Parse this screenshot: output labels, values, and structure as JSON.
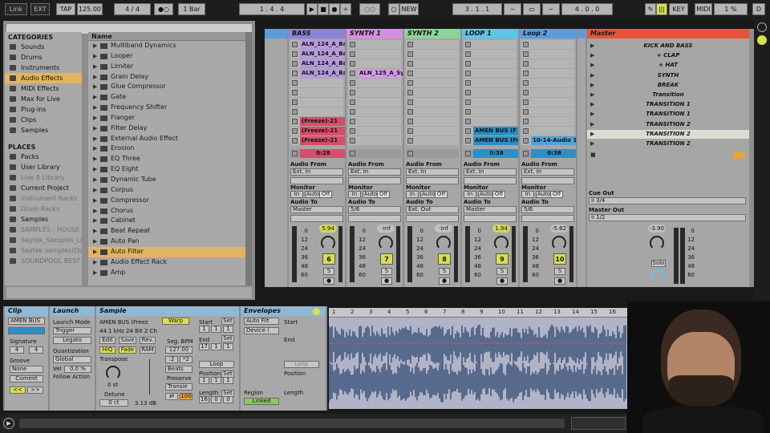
{
  "topbar": {
    "link": "Link",
    "ext": "EXT",
    "tap": "TAP",
    "tempo": "125.00",
    "sig": "4 / 4",
    "metro": "1 Bar",
    "position": "1 .   4 .   4",
    "new": "NEW",
    "loop_start": "3 .   1 .   1",
    "loop_len": "4 .   0 .   0",
    "key": "KEY",
    "midi": "MIDI",
    "cpu": "1 %",
    "d": "D"
  },
  "browser": {
    "categories_title": "CATEGORIES",
    "categories": [
      {
        "label": "Sounds",
        "sel": false
      },
      {
        "label": "Drums",
        "sel": false
      },
      {
        "label": "Instruments",
        "sel": false
      },
      {
        "label": "Audio Effects",
        "sel": true
      },
      {
        "label": "MIDI Effects",
        "sel": false
      },
      {
        "label": "Max for Live",
        "sel": false
      },
      {
        "label": "Plug-ins",
        "sel": false
      },
      {
        "label": "Clips",
        "sel": false
      },
      {
        "label": "Samples",
        "sel": false
      }
    ],
    "places_title": "PLACES",
    "places": [
      {
        "label": "Packs",
        "gray": false
      },
      {
        "label": "User Library",
        "gray": false
      },
      {
        "label": "Live 8 Library",
        "gray": true
      },
      {
        "label": "Current Project",
        "gray": false
      },
      {
        "label": "Instrument Racks",
        "gray": true
      },
      {
        "label": "Drum Racks",
        "gray": true
      },
      {
        "label": "Samples",
        "gray": false
      },
      {
        "label": "SAMPLES - HOUSE",
        "gray": true
      },
      {
        "label": "Saytek_Samples_Li",
        "gray": true
      },
      {
        "label": "Saytek samples(OLC",
        "gray": true
      },
      {
        "label": "SOUNDPOOL BEST",
        "gray": true
      }
    ],
    "name_header": "Name",
    "items": [
      {
        "label": "Multiband Dynamics",
        "sel": false
      },
      {
        "label": "Looper",
        "sel": false
      },
      {
        "label": "Limiter",
        "sel": false
      },
      {
        "label": "Grain Delay",
        "sel": false
      },
      {
        "label": "Glue Compressor",
        "sel": false
      },
      {
        "label": "Gate",
        "sel": false
      },
      {
        "label": "Frequency Shifter",
        "sel": false
      },
      {
        "label": "Flanger",
        "sel": false
      },
      {
        "label": "Filter Delay",
        "sel": false
      },
      {
        "label": "External Audio Effect",
        "sel": false
      },
      {
        "label": "Erosion",
        "sel": false
      },
      {
        "label": "EQ Three",
        "sel": false
      },
      {
        "label": "EQ Eight",
        "sel": false
      },
      {
        "label": "Dynamic Tube",
        "sel": false
      },
      {
        "label": "Corpus",
        "sel": false
      },
      {
        "label": "Compressor",
        "sel": false
      },
      {
        "label": "Chorus",
        "sel": false
      },
      {
        "label": "Cabinet",
        "sel": false
      },
      {
        "label": "Beat Repeat",
        "sel": false
      },
      {
        "label": "Auto Pan",
        "sel": false
      },
      {
        "label": "Auto Filter",
        "sel": true
      },
      {
        "label": "Audio Effect Rack",
        "sel": false
      },
      {
        "label": "Amp",
        "sel": false
      }
    ]
  },
  "tracks": [
    {
      "name": "BASS",
      "color": "#8b84d8",
      "clips": [
        "ALN_124_A_Ba",
        "ALN_124_A_Ba",
        "ALN_124_A_Ba",
        "ALN_124_A_Ba",
        "",
        "",
        "",
        "",
        "(Freeze)-21",
        "(Freeze)-21",
        "(Freeze)-21"
      ],
      "clipcolor": [
        "#b79be0",
        "#b79be0",
        "#b79be0",
        "#b79be0",
        "",
        "",
        "",
        "",
        "#d64f6a",
        "#d64f6a",
        "#d64f6a"
      ],
      "stop_value": "0:28",
      "audio_from": "Audio From",
      "from_src": "Ext. In",
      "monitor": "Monitor",
      "mon": [
        "In",
        "Auto",
        "Off"
      ],
      "audio_to": "Audio To",
      "to_dst": "Master",
      "vol": "5.94",
      "volhl": true,
      "num": "6"
    },
    {
      "name": "SYNTH 1",
      "color": "#d68fe0",
      "clips": [
        "",
        "",
        "",
        "ALN_125_A_Syn",
        "",
        "",
        "",
        "",
        "",
        "",
        ""
      ],
      "clipcolor": [
        "",
        "",
        "",
        "#d59ae6",
        "",
        "",
        "",
        "",
        "",
        "",
        ""
      ],
      "stop_value": "",
      "audio_from": "Audio From",
      "from_src": "Ext. In",
      "monitor": "Monitor",
      "mon": [
        "In",
        "Auto",
        "Off"
      ],
      "audio_to": "Audio To",
      "to_dst": "5/6",
      "vol": "-Inf",
      "volhl": false,
      "num": "7"
    },
    {
      "name": "SYNTH 2",
      "color": "#8ed29b",
      "clips": [
        "",
        "",
        "",
        "",
        "",
        "",
        "",
        "",
        "",
        "",
        ""
      ],
      "clipcolor": [
        "",
        "",
        "",
        "",
        "",
        "",
        "",
        "",
        "",
        "",
        ""
      ],
      "stop_value": "",
      "audio_from": "Audio From",
      "from_src": "Ext. In",
      "monitor": "Monitor",
      "mon": [
        "In",
        "Auto",
        "Off"
      ],
      "audio_to": "Audio To",
      "to_dst": "Ext. Out",
      "vol": "-Inf",
      "volhl": false,
      "num": "8"
    },
    {
      "name": "LOOP 1",
      "color": "#5cc5e8",
      "clips": [
        "",
        "",
        "",
        "",
        "",
        "",
        "",
        "",
        "",
        "AMEN BUS (F",
        "AMEN BUS (Fr"
      ],
      "clipcolor": [
        "",
        "",
        "",
        "",
        "",
        "",
        "",
        "",
        "",
        "#2a91c7",
        "#2a91c7"
      ],
      "stop_value": "0:38",
      "audio_from": "Audio From",
      "from_src": "Ext. In",
      "monitor": "Monitor",
      "mon": [
        "In",
        "Auto",
        "Off"
      ],
      "audio_to": "Audio To",
      "to_dst": "Master",
      "vol": "1.94",
      "volhl": true,
      "num": "9"
    },
    {
      "name": "Loop 2",
      "color": "#5b9ddc",
      "clips": [
        "",
        "",
        "",
        "",
        "",
        "",
        "",
        "",
        "",
        "",
        "10-14-Audio 1"
      ],
      "clipcolor": [
        "",
        "",
        "",
        "",
        "",
        "",
        "",
        "",
        "",
        "",
        "#4fa5d9"
      ],
      "stop_value": "0:38",
      "audio_from": "Audio From",
      "from_src": "Ext. In",
      "monitor": "Monitor",
      "mon": [
        "In",
        "Auto",
        "Off"
      ],
      "audio_to": "Audio To",
      "to_dst": "5/6",
      "vol": "-5.62",
      "volhl": false,
      "num": "10"
    }
  ],
  "master": {
    "name": "Master",
    "scenes": [
      "KICK AND BASS",
      "+ CLAP",
      "+ HAT",
      "SYNTH",
      "BREAK",
      "Transition",
      "TRANSITION 1",
      "TRANSITION 1",
      "TRANSITION 2",
      "TRANSITION 2",
      "TRANSITION 2"
    ],
    "cue_out": "Cue Out",
    "cue_val": "ii 3/4",
    "master_out": "Master Out",
    "master_val": "ii 1/2",
    "vol": "-3.90",
    "solo": "Solo"
  },
  "db_scale": [
    "0",
    "12",
    "24",
    "36",
    "48",
    "60"
  ],
  "detail": {
    "clip_title": "Clip",
    "clip_name": "AMEN BUS",
    "signature": "Signature",
    "sig_n": "4",
    "sig_d": "4",
    "groove": "Groove",
    "groove_val": "None",
    "commit": "Commit",
    "launch_title": "Launch",
    "launch_mode": "Launch Mode",
    "trigger": "Trigger",
    "legato": "Legato",
    "quant": "Quantization",
    "global": "Global",
    "vel": "Vel",
    "vel_val": "0.0 %",
    "follow": "Follow Action",
    "sample_title": "Sample",
    "sample_name": "AMEN BUS (Freez",
    "sample_info": "44.1 kHz 24 Bit 2 Ch",
    "warp": "Warp",
    "edit": "Edit",
    "save": "Save",
    "rev": "Rev.",
    "hiq": "HiQ",
    "fade": "Fade",
    "ram": "RAM",
    "seg_bpm": "Seg. BPM",
    "bpm": "127.00",
    "transpose": "Transpose",
    "transpose_val": "0 st",
    "beats": "Beats",
    "preserve": "Preserve",
    "transient": "Transie",
    "detune": "Detune",
    "detune_val": "0 ct",
    "gain": "3.13 dB",
    "mult": "100",
    "start": "Start",
    "end": "End",
    "loop": "Loop",
    "position": "Position",
    "length": "Length",
    "set": "Set",
    "env_title": "Envelopes",
    "env1": "Auto Filt",
    "env2": "Device (",
    "region": "Region",
    "linked": "Linked",
    "start_val": [
      "1",
      "1",
      "1"
    ],
    "end_val": [
      "17",
      "1",
      "1"
    ],
    "pos_val": [
      "1",
      "1",
      "1"
    ],
    "len_val": [
      "16",
      "0",
      "0"
    ]
  },
  "ruler": [
    "1",
    "2",
    "3",
    "4",
    "5",
    "6",
    "7",
    "8",
    "9",
    "10",
    "11",
    "12",
    "13",
    "14",
    "15",
    "16"
  ]
}
